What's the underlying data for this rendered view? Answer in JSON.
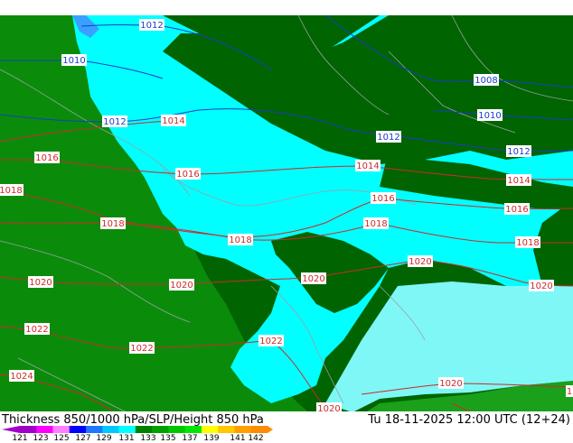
{
  "map": {
    "colors": {
      "dark_green": "#006400",
      "green": "#0a8c0a",
      "cyan": "#00ffff",
      "pale_cyan": "#80ffff",
      "isobar_red": "#cc2a2a",
      "isobar_blue": "#1a3cc8",
      "coast": "#9aa0a6"
    },
    "isobar_labels": [
      {
        "text": "1012",
        "color": "blue"
      },
      {
        "text": "1010",
        "color": "blue"
      },
      {
        "text": "1012",
        "color": "blue"
      },
      {
        "text": "1014",
        "color": "red"
      },
      {
        "text": "1016",
        "color": "red"
      },
      {
        "text": "1018",
        "color": "red"
      },
      {
        "text": "1016",
        "color": "red"
      },
      {
        "text": "1018",
        "color": "red"
      },
      {
        "text": "1018",
        "color": "red"
      },
      {
        "text": "1020",
        "color": "red"
      },
      {
        "text": "1020",
        "color": "red"
      },
      {
        "text": "1020",
        "color": "red"
      },
      {
        "text": "1022",
        "color": "red"
      },
      {
        "text": "1022",
        "color": "red"
      },
      {
        "text": "1022",
        "color": "red"
      },
      {
        "text": "1024",
        "color": "red"
      },
      {
        "text": "1008",
        "color": "blue"
      },
      {
        "text": "1010",
        "color": "blue"
      },
      {
        "text": "1012",
        "color": "blue"
      },
      {
        "text": "1012",
        "color": "blue"
      },
      {
        "text": "1014",
        "color": "red"
      },
      {
        "text": "1014",
        "color": "red"
      },
      {
        "text": "1016",
        "color": "red"
      },
      {
        "text": "1016",
        "color": "red"
      },
      {
        "text": "1018",
        "color": "red"
      },
      {
        "text": "1018",
        "color": "red"
      },
      {
        "text": "1020",
        "color": "red"
      },
      {
        "text": "1020",
        "color": "red"
      },
      {
        "text": "1020",
        "color": "red"
      },
      {
        "text": "1020",
        "color": "red"
      },
      {
        "text": "1018",
        "color": "red"
      },
      {
        "text": "1",
        "color": "red"
      }
    ]
  },
  "footer": {
    "title": "Thickness 850/1000 hPa/SLP/Height 850 hPa",
    "time": "Tu 18-11-2025 12:00 UTC (12+24)",
    "scale": {
      "ticks": [
        "121",
        "123",
        "125",
        "127",
        "129",
        "131",
        "133",
        "135",
        "137",
        "139",
        "141",
        "142"
      ],
      "colors": [
        "#a000c8",
        "#ff00ff",
        "#ff80ff",
        "#0000ff",
        "#1e78ff",
        "#00c8ff",
        "#00ffff",
        "#008000",
        "#00a000",
        "#00c800",
        "#00e600",
        "#ffff00",
        "#ffc800",
        "#ffa000",
        "#ff8c00"
      ]
    }
  }
}
